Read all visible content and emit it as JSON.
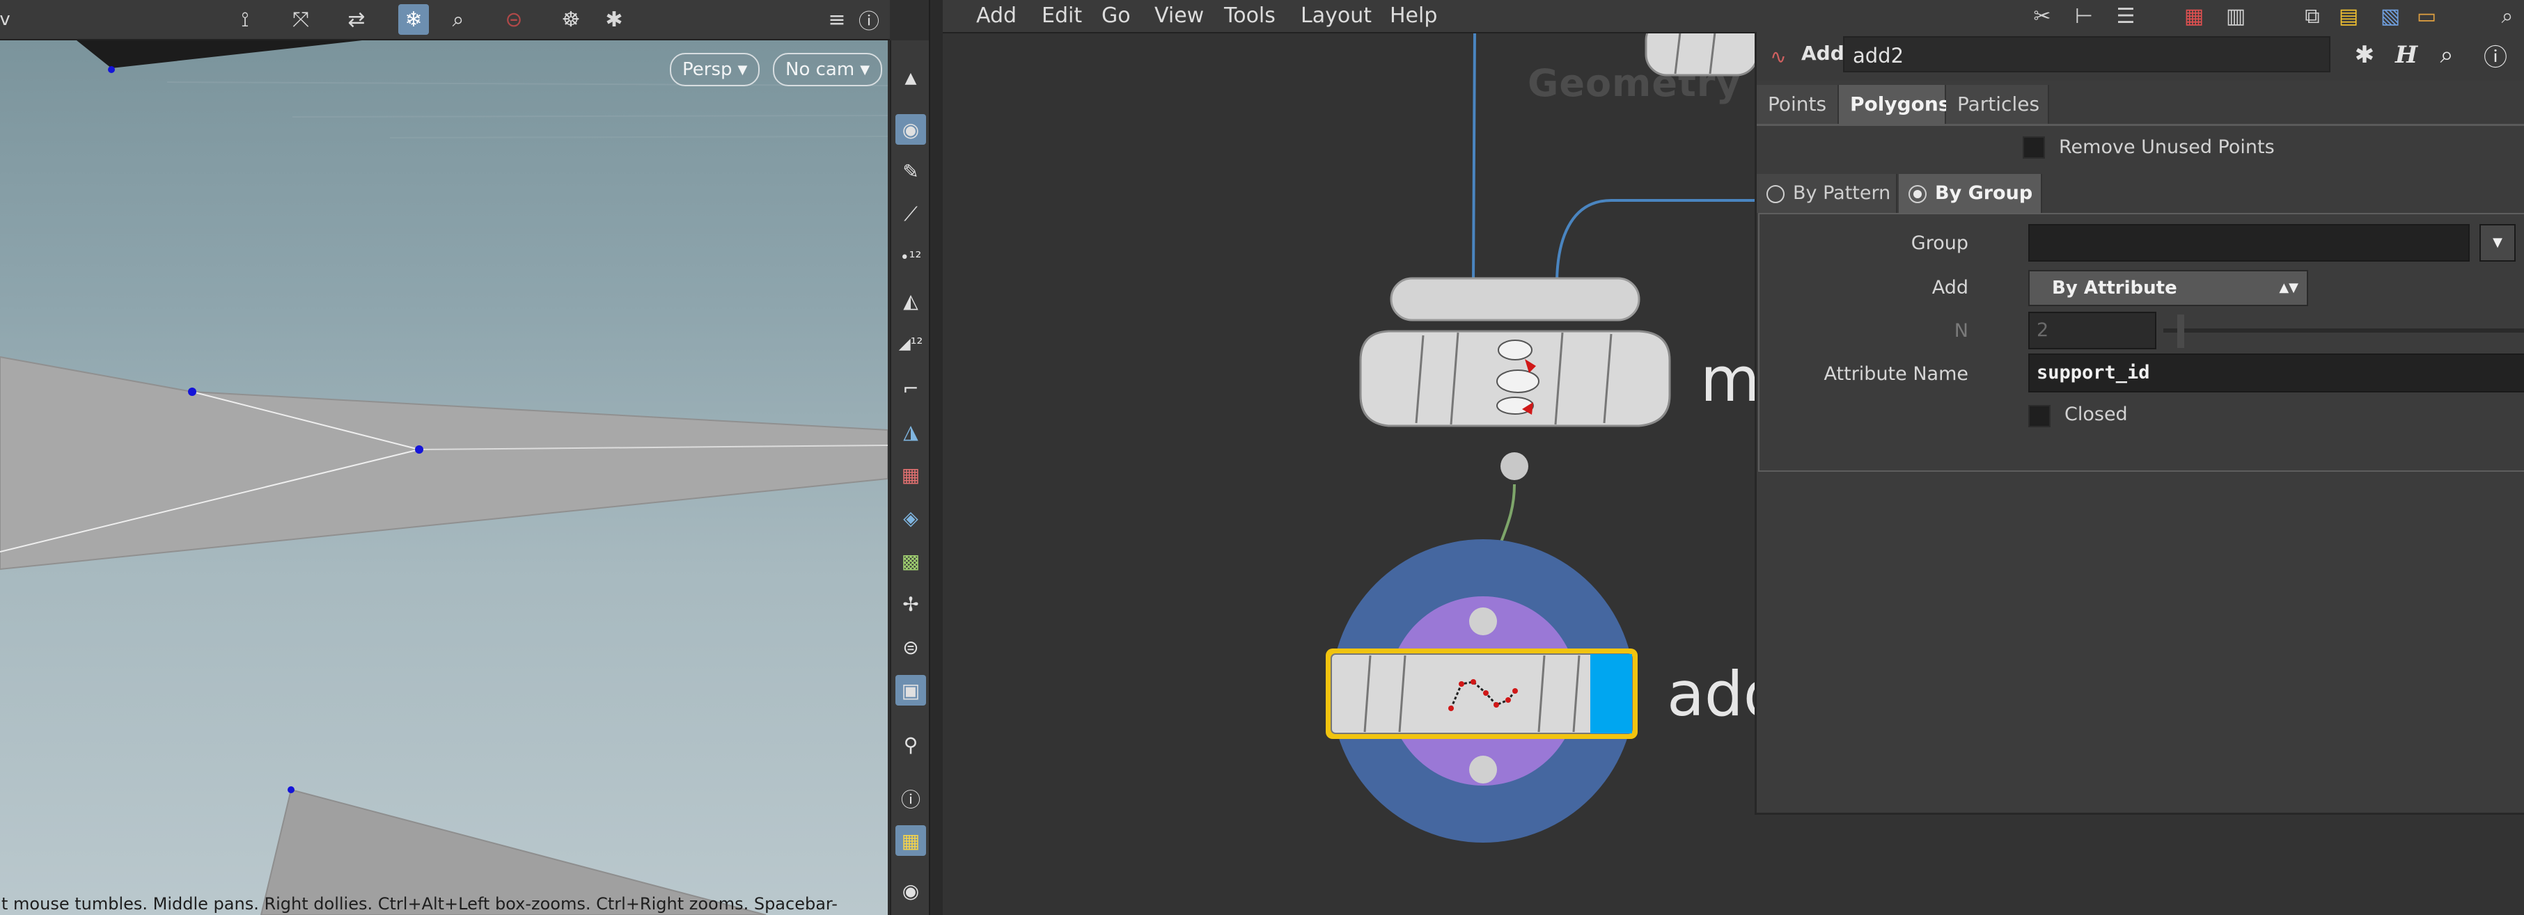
{
  "viewport": {
    "toolbar_icons": [
      "handle-tool-icon",
      "pose-tool-icon",
      "transform-tool-icon",
      "snapping-icon",
      "view-icon",
      "no-entry-icon",
      "render-icon",
      "display-options-icon"
    ],
    "camera_persp_label": "Persp",
    "camera_select_label": "No cam",
    "status_text": "t mouse tumbles. Middle pans. Right dollies. Ctrl+Alt+Left box-zooms. Ctrl+Right zooms. Spacebar-",
    "side_tools": [
      "select-points-icon",
      "edit-icon",
      "pin-icon",
      "point-number-icon",
      "paint-icon",
      "prim-number-icon",
      "angle-icon",
      "brush-icon",
      "texture-icon",
      "geometry-icon",
      "uv-icon",
      "pivot-icon",
      "layers-icon",
      "snapshot-icon",
      "location-icon",
      "info-icon",
      "grid-icon",
      "eye-icon"
    ],
    "colors": {
      "sky_top": "#7b949c",
      "sky_bottom": "#bac8cd",
      "geometry": "#a8a8a8",
      "point": "#1414d8"
    }
  },
  "menu": {
    "items": [
      "Add",
      "Edit",
      "Go",
      "View",
      "Tools",
      "Layout",
      "Help"
    ],
    "right_icons": [
      "tools-icon",
      "tree-icon",
      "list-icon",
      "color-palette-icon",
      "grid-icon",
      "network-icon",
      "sticky-note-icon",
      "image-icon",
      "box-icon",
      "search-icon"
    ]
  },
  "network": {
    "context_label": "Geometry",
    "nodes": [
      {
        "name_fragment": "m",
        "type": "merge",
        "icon": "merge-icon"
      },
      {
        "name_fragment": "add",
        "type": "add",
        "icon": "add-curve-icon",
        "selected": true,
        "display_flag_color": "#00a6f0"
      }
    ],
    "colors": {
      "wire_blue": "#4a85c0",
      "wire_green": "#7ea66a",
      "ring_outer": "#4567a0",
      "ring_inner": "#9a78d6",
      "selection": "#f1c40f"
    }
  },
  "params": {
    "node_type": "Add",
    "node_name": "add2",
    "header_icons": [
      "gear-icon",
      "houdini-help-icon",
      "search-icon",
      "info-icon"
    ],
    "tabs": [
      "Points",
      "Polygons",
      "Particles"
    ],
    "active_tab": "Polygons",
    "remove_unused_points": "Remove Unused Points",
    "mode_tabs": [
      "By Pattern",
      "By Group"
    ],
    "active_mode": "By Group",
    "group": {
      "label": "Group",
      "value": ""
    },
    "add": {
      "label": "Add",
      "value": "By Attribute"
    },
    "n": {
      "label": "N",
      "value": "2"
    },
    "attribute_name": {
      "label": "Attribute Name",
      "value": "support_id"
    },
    "closed": {
      "label": "Closed"
    }
  }
}
